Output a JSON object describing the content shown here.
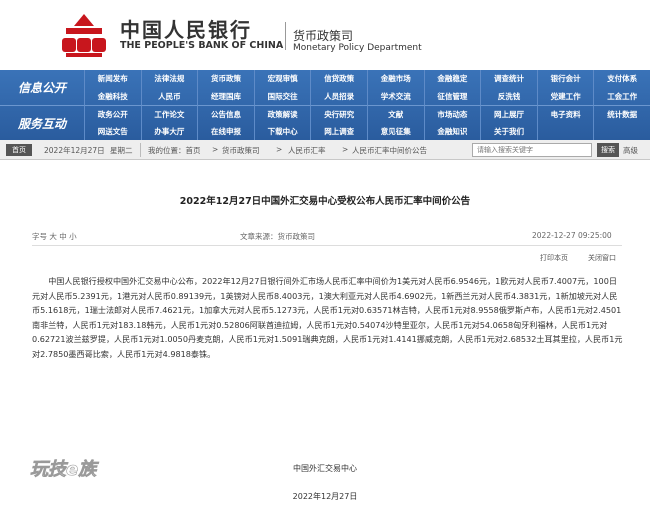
{
  "header": {
    "bank_cn": "中国人民银行",
    "bank_en": "THE PEOPLE'S BANK OF CHINA",
    "dept_cn": "货币政策司",
    "dept_en": "Monetary Policy Department",
    "logo_color": "#c8161d"
  },
  "nav": {
    "section1": "信息公开",
    "section2": "服务互动",
    "rows": [
      [
        "新闻发布",
        "法律法规",
        "货币政策",
        "宏观审慎",
        "信贷政策",
        "金融市场",
        "金融稳定",
        "调查统计",
        "银行会计",
        "支付体系"
      ],
      [
        "金融科技",
        "人民币",
        "经理国库",
        "国际交往",
        "人员招录",
        "学术交流",
        "征信管理",
        "反洗钱",
        "党建工作",
        "工会工作"
      ],
      [
        "政务公开",
        "工作论文",
        "公告信息",
        "政策解读",
        "央行研究",
        "文献",
        "市场动态",
        "网上展厅",
        "电子资料",
        "统计数据"
      ],
      [
        "网送文告",
        "办事大厅",
        "在线申报",
        "下载中心",
        "网上调查",
        "意见征集",
        "金融知识",
        "关于我们",
        "",
        ""
      ]
    ]
  },
  "toolbar": {
    "home": "首页",
    "date": "2022年12月27日",
    "weekday": "星期二",
    "location_label": "我的位置：首页",
    "crumb1": "货币政策司",
    "crumb2": "人民币汇率",
    "crumb3": "人民币汇率中间价公告",
    "search_placeholder": "请输入搜索关键字",
    "search_button": "搜索",
    "advanced": "高级"
  },
  "article": {
    "title": "2022年12月27日中国外汇交易中心受权公布人民币汇率中间价公告",
    "author": "字号 大 中 小",
    "source": "文章来源：货币政策司",
    "date": "2022-12-27 09:25:00",
    "print": "打印本页",
    "close": "关闭窗口",
    "body": "中国人民银行授权中国外汇交易中心公布，2022年12月27日银行间外汇市场人民币汇率中间价为1美元对人民币6.9546元，1欧元对人民币7.4007元，100日元对人民币5.2391元，1港元对人民币0.89139元，1英镑对人民币8.4003元，1澳大利亚元对人民币4.6902元，1新西兰元对人民币4.3831元，1新加坡元对人民币5.1618元，1瑞士法郎对人民币7.4621元，1加拿大元对人民币5.1273元，人民币1元对0.63571林吉特，人民币1元对8.9558俄罗斯卢布，人民币1元对2.4501南非兰特，人民币1元对183.18韩元，人民币1元对0.52806阿联酋迪拉姆，人民币1元对0.54074沙特里亚尔，人民币1元对54.0658匈牙利福林，人民币1元对0.62721波兰兹罗提，人民币1元对1.0050丹麦克朗，人民币1元对1.5091瑞典克朗，人民币1元对1.4141挪威克朗，人民币1元对2.68532土耳其里拉，人民币1元对2.7850墨西哥比索，人民币1元对4.9818泰铢。",
    "signer": "中国外汇交易中心",
    "sign_date": "2022年12月27日"
  },
  "watermark": {
    "text": "玩技e族"
  }
}
